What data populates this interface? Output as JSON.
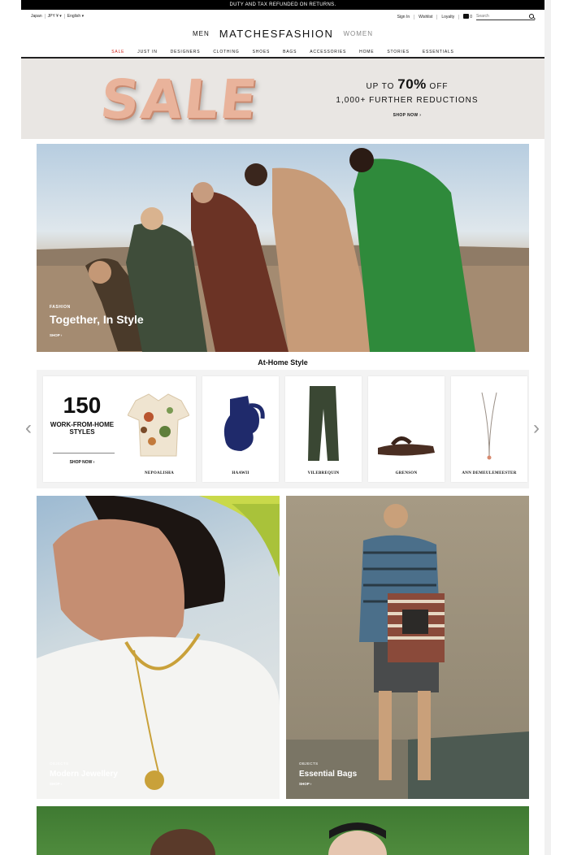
{
  "topbar": {
    "message": "DUTY AND TAX REFUNDED ON RETURNS."
  },
  "utility": {
    "country": "Japan",
    "currency": "JPY ¥ ▾",
    "language": "English ▾",
    "sign_in": "Sign In",
    "wishlist": "Wishlist",
    "loyalty": "Loyalty",
    "bag_count": "0",
    "search_placeholder": "Search"
  },
  "brand": {
    "men": "MEN",
    "logo": "MATCHESFASHION",
    "women": "WOMEN"
  },
  "nav": [
    "SALE",
    "JUST IN",
    "DESIGNERS",
    "CLOTHING",
    "SHOES",
    "BAGS",
    "ACCESSORIES",
    "HOME",
    "STORIES",
    "ESSENTIALS"
  ],
  "sale_banner": {
    "word": "SALE",
    "line1_prefix": "UP TO ",
    "line1_big": "70%",
    "line1_suffix": " OFF",
    "line2": "1,000+ FURTHER REDUCTIONS",
    "cta": "SHOP NOW ›"
  },
  "hero": {
    "tag": "FASHION",
    "title": "Together, In Style",
    "cta": "SHOP ›"
  },
  "at_home": {
    "title": "At-Home Style",
    "promo_number": "150",
    "promo_text": "WORK-FROM-HOME STYLES",
    "promo_cta": "SHOP NOW ›",
    "products": [
      {
        "brand": "NEPOALISHA"
      },
      {
        "brand": "HAAWII"
      },
      {
        "brand": "VILEBREQUIN"
      },
      {
        "brand": "GRENSON"
      },
      {
        "brand": "ANN DEMEULEMEESTER"
      }
    ]
  },
  "tiles": [
    {
      "tag": "OBJECTS",
      "title": "Modern Jewellery",
      "cta": "SHOP ›"
    },
    {
      "tag": "OBJECTS",
      "title": "Essential Bags",
      "cta": "SHOP ›"
    }
  ],
  "colors": {
    "sale_red": "#d0241b",
    "banner_bg": "#e9e6e3",
    "accent_copper": "#e9b39b"
  }
}
